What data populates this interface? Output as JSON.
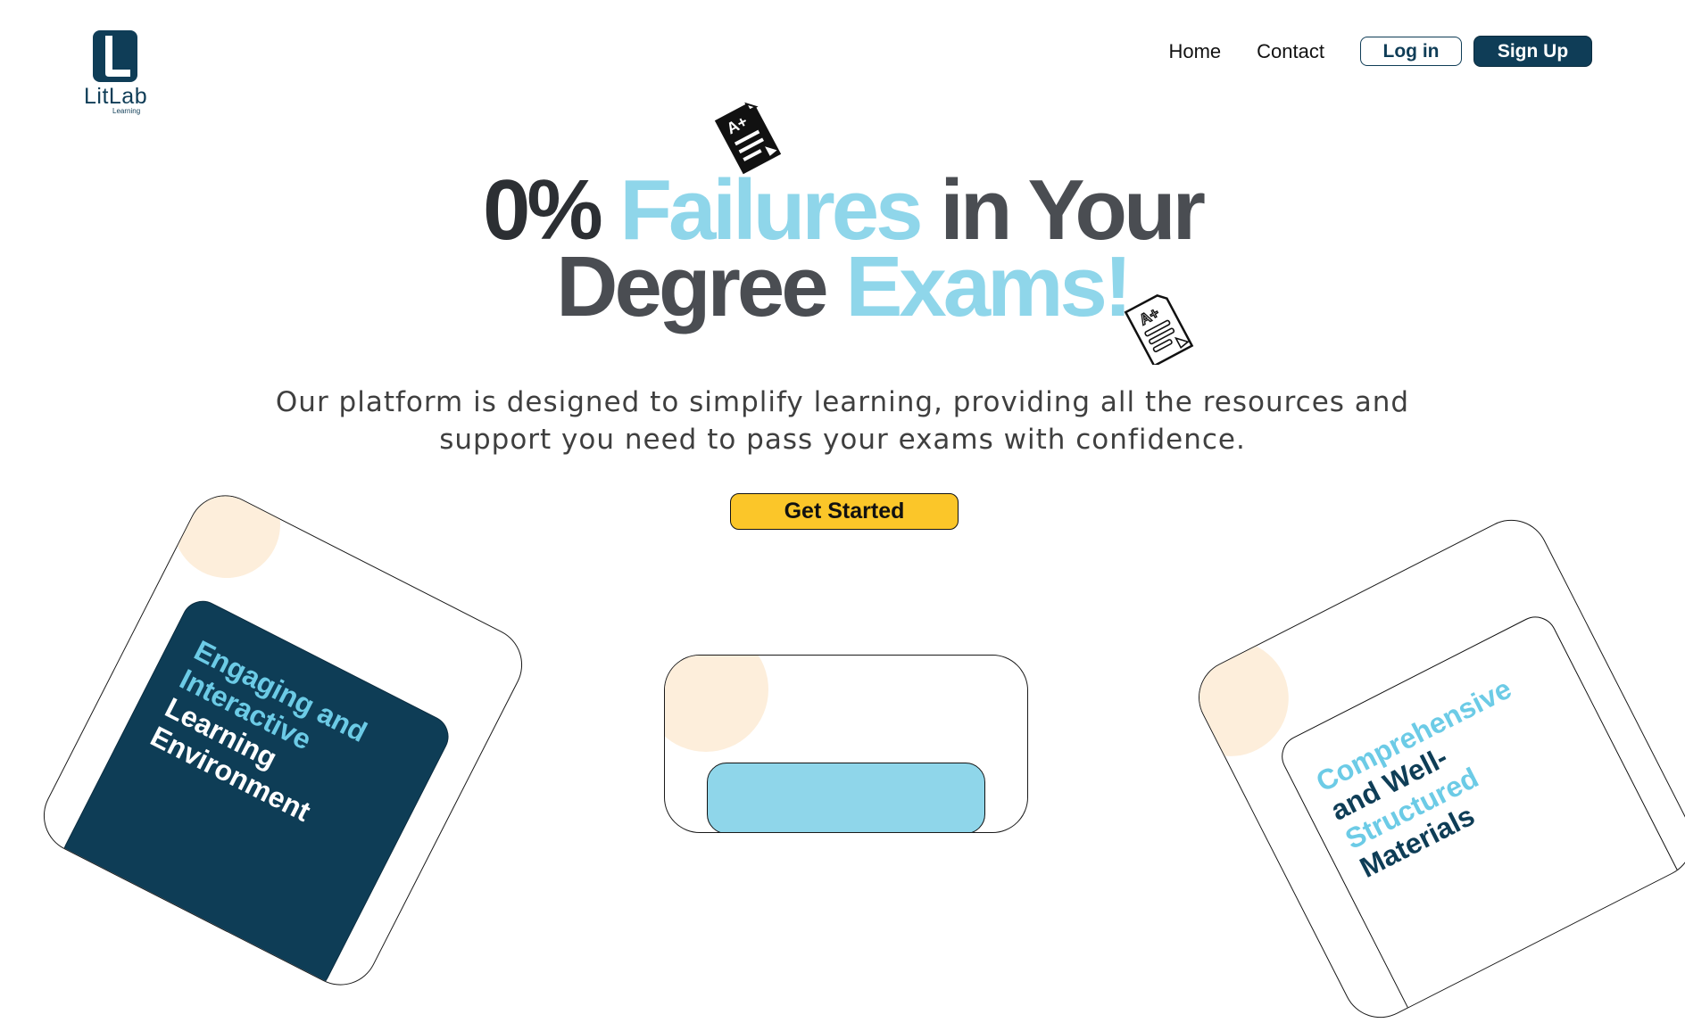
{
  "brand": {
    "name": "LitLab",
    "tagline": "Learning",
    "primary_color": "#0f3d57",
    "accent_color": "#8fd6ea",
    "cta_color": "#fbc629"
  },
  "nav": {
    "home": "Home",
    "contact": "Contact",
    "login": "Log in",
    "signup": "Sign Up"
  },
  "hero": {
    "title_part1": "0%",
    "title_part2": "Failures",
    "title_part3": "in Your",
    "title_part4": "Degree",
    "title_part5": "Exams!",
    "description_line1": "Our platform is designed to simplify learning, providing all the resources and",
    "description_line2": "support you need to pass your exams with confidence.",
    "cta": "Get Started",
    "icons": [
      "graded-paper-icon",
      "graded-paper-outline-icon"
    ]
  },
  "cards": {
    "left": {
      "line1": "Engaging and",
      "line2": "Interactive",
      "line3": "Learning",
      "line4": "Environment"
    },
    "right": {
      "line1": "Comprehensive",
      "line2": "and Well-",
      "line3": "Structured",
      "line4": "Materials"
    }
  }
}
